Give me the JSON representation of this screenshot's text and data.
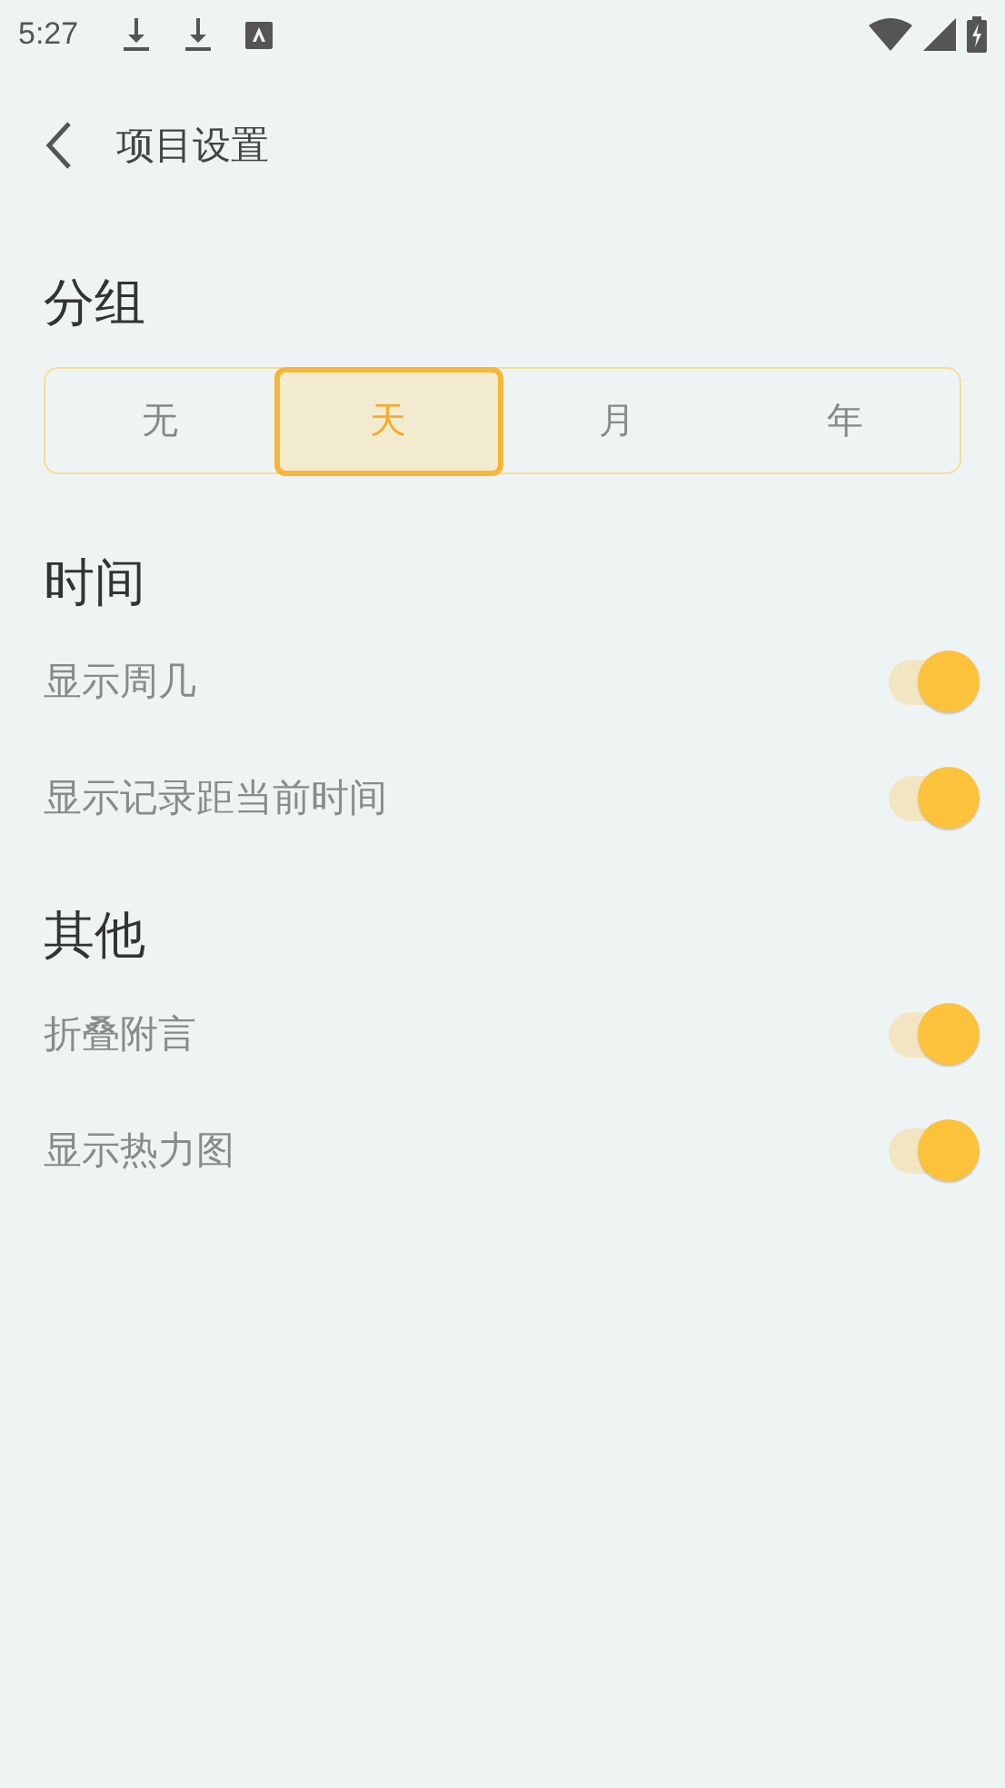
{
  "status_bar": {
    "time": "5:27"
  },
  "header": {
    "title": "项目设置"
  },
  "grouping": {
    "title": "分组",
    "options": [
      {
        "label": "无",
        "selected": false
      },
      {
        "label": "天",
        "selected": true
      },
      {
        "label": "月",
        "selected": false
      },
      {
        "label": "年",
        "selected": false
      }
    ]
  },
  "sections": [
    {
      "title": "时间",
      "items": [
        {
          "label": "显示周几",
          "on": true
        },
        {
          "label": "显示记录距当前时间",
          "on": true
        }
      ]
    },
    {
      "title": "其他",
      "items": [
        {
          "label": "折叠附言",
          "on": true
        },
        {
          "label": "显示热力图",
          "on": true
        }
      ]
    }
  ]
}
